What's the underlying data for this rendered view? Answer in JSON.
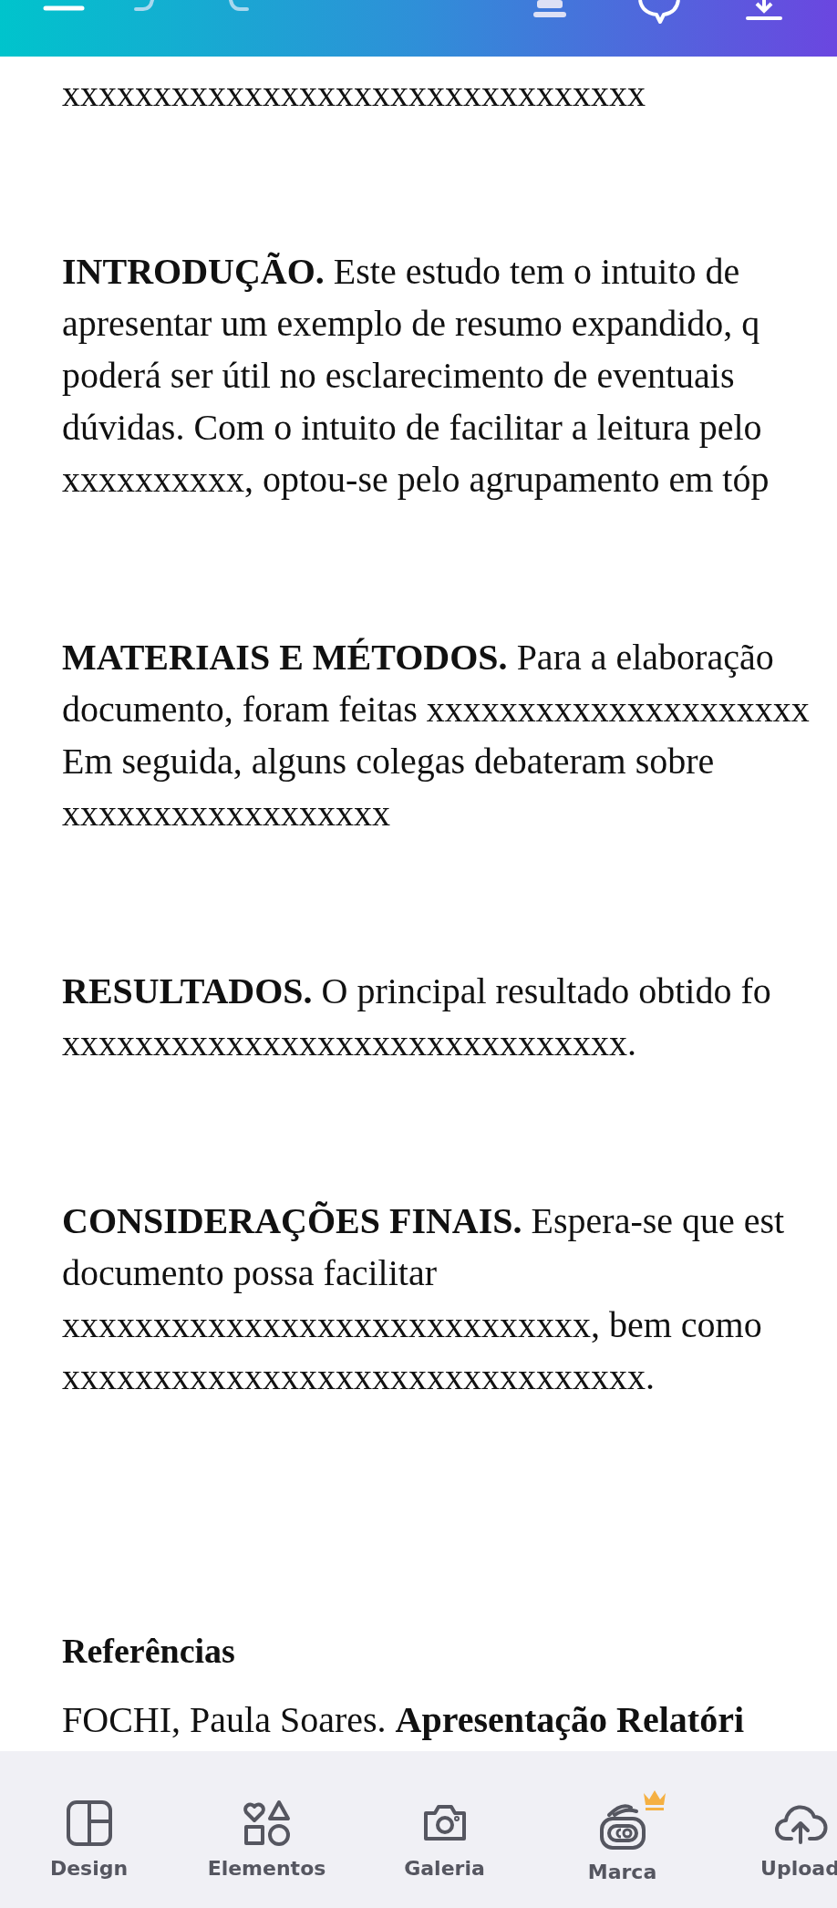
{
  "document": {
    "lead_line": "xxxxxxxxxxxxxxxxxxxxxxxxxxxxxxxx",
    "paragraphs": [
      {
        "lines": [
          "**INTRODUÇÃO.** Este estudo tem o intuito de",
          "apresentar um exemplo de resumo expandido, q",
          "poderá ser útil no esclarecimento de eventuais",
          "dúvidas. Com o intuito de facilitar a leitura pelo",
          "xxxxxxxxxx, optou-se pelo agrupamento em tóp"
        ]
      },
      {
        "lines": [
          "**MATERIAIS E MÉTODOS.** Para a elaboração",
          "documento, foram feitas xxxxxxxxxxxxxxxxxxxxx",
          "Em seguida, alguns colegas debateram sobre",
          "xxxxxxxxxxxxxxxxxx"
        ]
      },
      {
        "lines": [
          "**RESULTADOS.** O principal resultado obtido fo",
          "xxxxxxxxxxxxxxxxxxxxxxxxxxxxxxx."
        ]
      },
      {
        "lines": [
          "**CONSIDERAÇÕES FINAIS.** Espera-se que est",
          "documento possa facilitar",
          "xxxxxxxxxxxxxxxxxxxxxxxxxxxxx, bem como",
          "xxxxxxxxxxxxxxxxxxxxxxxxxxxxxxxx."
        ]
      }
    ],
    "references_heading": "Referências",
    "reference_line": "FOCHI, Paula Soares. **Apresentação Relatóri**"
  },
  "bottom_nav": [
    {
      "kind": "design",
      "label": "Design"
    },
    {
      "kind": "elements",
      "label": "Elementos"
    },
    {
      "kind": "gallery",
      "label": "Galeria"
    },
    {
      "kind": "brand",
      "label": "Marca",
      "premium": true
    },
    {
      "kind": "upload",
      "label": "Upload"
    }
  ]
}
